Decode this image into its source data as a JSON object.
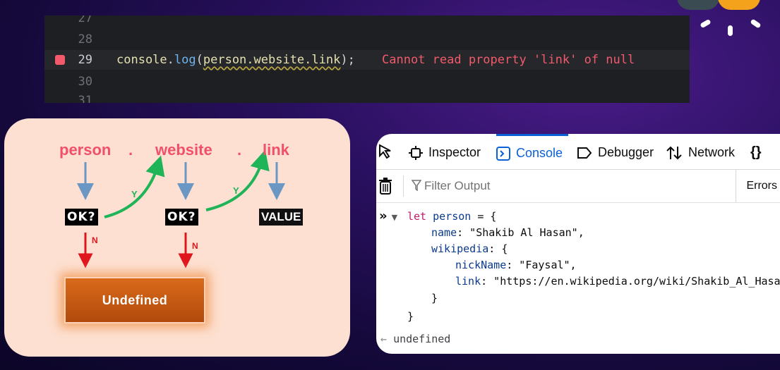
{
  "editor": {
    "lines": [
      {
        "num": "27"
      },
      {
        "num": "28"
      },
      {
        "num": "29",
        "code": {
          "obj": "console",
          "dot": ".",
          "fn": "log",
          "open": "(",
          "arg": "person.website.link",
          "close": ");"
        },
        "error": "Cannot read property 'link' of null"
      },
      {
        "num": "30"
      },
      {
        "num": "31"
      }
    ],
    "colors": {
      "breakpoint": "#f25a6b",
      "error": "#f25a6b"
    }
  },
  "diagram": {
    "tokens": [
      "person",
      ".",
      "website",
      ".",
      "link"
    ],
    "check_label": "OK?",
    "value_label": "VALUE",
    "yes_label": "Y",
    "no_label": "N",
    "undefined_label": "Undefined",
    "colors": {
      "token": "#f0506a",
      "down_arrow": "#6a97c4",
      "yes_arrow": "#1fb457",
      "no_arrow": "#e0161e",
      "undefined_box": "#c85a14"
    }
  },
  "devtools": {
    "tabs": [
      {
        "label": "Inspector",
        "icon": "inspector-icon"
      },
      {
        "label": "Console",
        "icon": "console-icon",
        "selected": true
      },
      {
        "label": "Debugger",
        "icon": "debugger-icon"
      },
      {
        "label": "Network",
        "icon": "network-icon"
      }
    ],
    "filter_placeholder": "Filter Output",
    "errors_label": "Errors",
    "code": {
      "l1": {
        "kw": "let",
        "var": "person",
        "rest": " = {"
      },
      "l2": {
        "key": "name",
        "rest": ": \"Shakib Al Hasan\","
      },
      "l3": {
        "key": "wikipedia",
        "rest": ": {"
      },
      "l4": {
        "key": "nickName",
        "rest": ": \"Faysal\","
      },
      "l5": {
        "key": "link",
        "rest": ": \"https://en.wikipedia.org/wiki/Shakib_Al_Hasan\""
      },
      "l6": "}",
      "l7": "}"
    },
    "result": "undefined",
    "colors": {
      "accent": "#0a60d6",
      "keyword": "#c21b6b"
    }
  }
}
